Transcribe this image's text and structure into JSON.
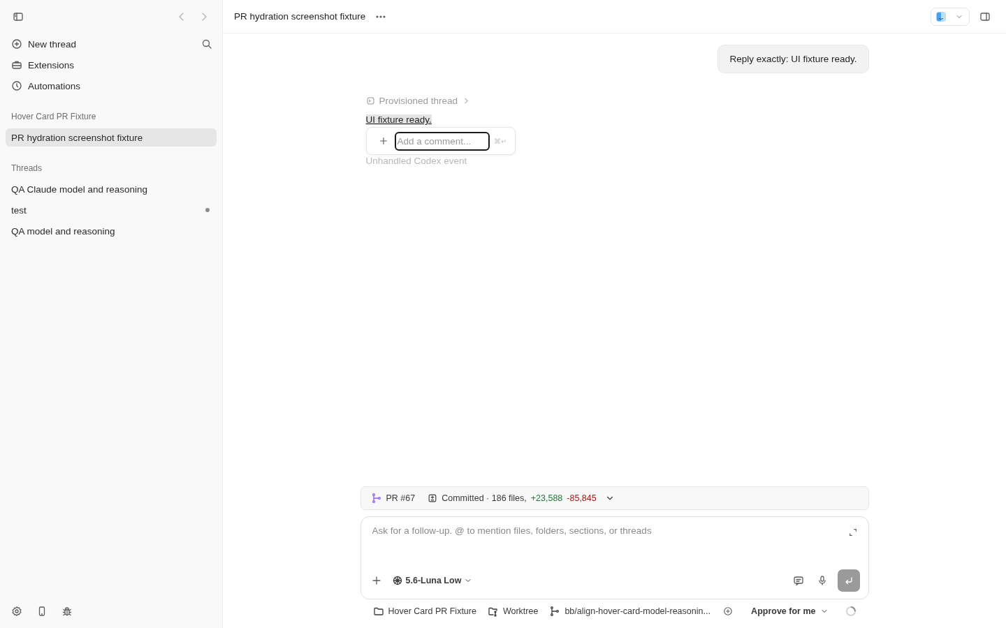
{
  "sidebar": {
    "nav": [
      {
        "label": "New thread",
        "kind": "new"
      },
      {
        "label": "Extensions",
        "kind": "extensions"
      },
      {
        "label": "Automations",
        "kind": "automations"
      }
    ],
    "sections": [
      {
        "title": "Hover Card PR Fixture",
        "threads": [
          {
            "label": "PR hydration screenshot fixture",
            "selected": true,
            "unread": false
          }
        ]
      },
      {
        "title": "Threads",
        "threads": [
          {
            "label": "QA Claude model and reasoning",
            "selected": false,
            "unread": false
          },
          {
            "label": "test",
            "selected": false,
            "unread": true
          },
          {
            "label": "QA model and reasoning",
            "selected": false,
            "unread": false
          }
        ]
      }
    ]
  },
  "header": {
    "title": "PR hydration screenshot fixture"
  },
  "conversation": {
    "user_message": "Reply exactly: UI fixture ready.",
    "provisioned": "Provisioned thread",
    "reply": "UI fixture ready.",
    "event": "Unhandled Codex event",
    "comment_popover": {
      "placeholder": "Add a comment...",
      "shortcut": "⌘↵"
    }
  },
  "pr_bar": {
    "pr": "PR #67",
    "status": "Committed · 186 files,",
    "added": "+23,588",
    "removed": "-85,845"
  },
  "composer": {
    "placeholder": "Ask for a follow-up. @ to mention files, folders, sections, or threads",
    "model": "5.6-Luna Low"
  },
  "footer": {
    "folder": "Hover Card PR Fixture",
    "worktree": "Worktree",
    "branch": "bb/align-hover-card-model-reasonin...",
    "approval": "Approve for me"
  }
}
